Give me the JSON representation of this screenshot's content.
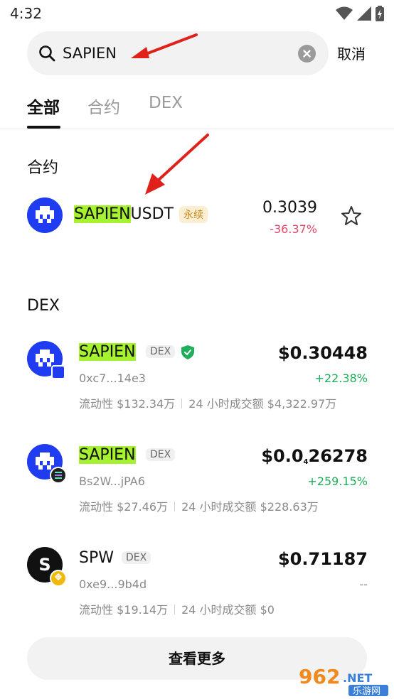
{
  "status": {
    "time": "4:32"
  },
  "search": {
    "value": "SAPIEN",
    "cancel": "取消"
  },
  "tabs": [
    {
      "label": "全部",
      "active": true
    },
    {
      "label": "合约",
      "active": false
    },
    {
      "label": "DEX",
      "active": false
    }
  ],
  "contracts": {
    "title": "合约",
    "items": [
      {
        "highlight": "SAPIEN",
        "rest": "USDT",
        "tag": "永续",
        "price": "0.3039",
        "change": "-36.37%"
      }
    ]
  },
  "dex": {
    "title": "DEX",
    "items": [
      {
        "name": "SAPIEN",
        "tag": "DEX",
        "address": "0xc7...14e3",
        "price": "$0.30448",
        "change": "+22.38%",
        "liquidity": "流动性 $132.34万",
        "volume": "24 小时成交额 $4,322.97万"
      },
      {
        "name": "SAPIEN",
        "tag": "DEX",
        "address": "Bs2W...jPA6",
        "price_prefix": "$0.0",
        "price_sub": "4",
        "price_suffix": "26278",
        "change": "+259.15%",
        "liquidity": "流动性 $27.46万",
        "volume": "24 小时成交额 $228.63万"
      },
      {
        "name": "SPW",
        "tag": "DEX",
        "address": "0xe9...9b4d",
        "price": "$0.71187",
        "change": "--",
        "liquidity": "流动性 $19.14万",
        "volume": "24 小时成交额 $0",
        "avatar_letter": "S"
      }
    ]
  },
  "more_button": "查看更多",
  "watermark": {
    "main": "962",
    "suffix": ".NET",
    "sub": "乐游网"
  },
  "colors": {
    "highlight": "#a6f230",
    "brand_blue": "#1f3cf0",
    "negative": "#e04a6a",
    "positive": "#1fae5a",
    "arrow": "#e0201b"
  }
}
